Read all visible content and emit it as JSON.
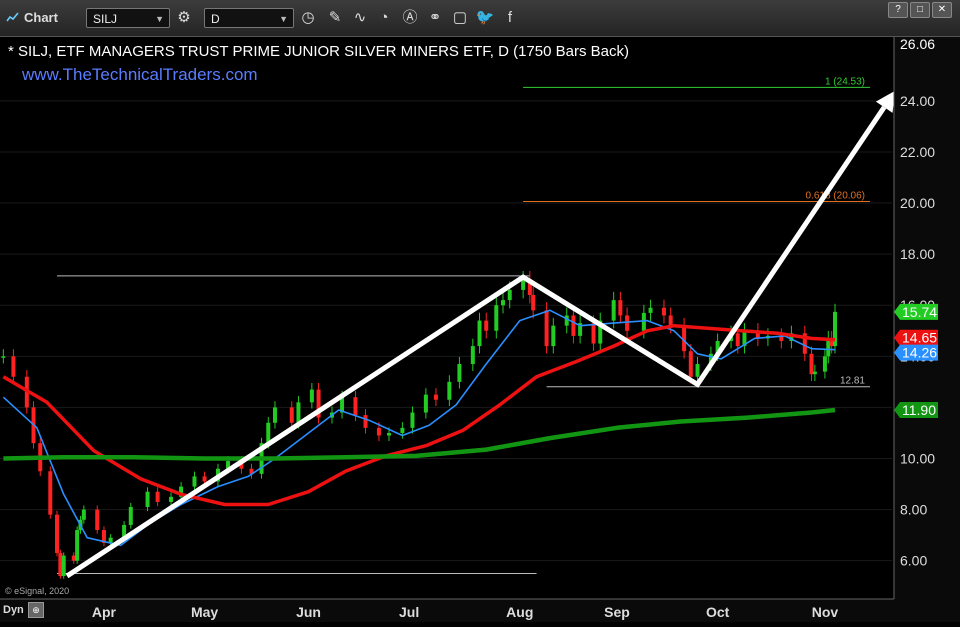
{
  "toolbar": {
    "title": "Chart",
    "symbol": "SILJ",
    "interval": "D",
    "win_buttons": [
      "?",
      "□",
      "✕"
    ]
  },
  "header": {
    "title": "* SILJ, ETF MANAGERS TRUST PRIME JUNIOR SILVER MINERS ETF, D (1750 Bars Back)",
    "website": "www.TheTechnicalTraders.com",
    "copyright": "© eSignal, 2020"
  },
  "footer": {
    "dyn_label": "Dyn"
  },
  "colors": {
    "bg": "#000000",
    "up": "#22cc22",
    "down": "#ff2222",
    "ma_fast": "#2a8fff",
    "ma_mid": "#ee1111",
    "ma_slow": "#129512",
    "fib1": "#33cc33",
    "fib618": "#e07020",
    "arrow": "#ffffff",
    "website": "#5a7dff"
  },
  "chart_data": {
    "type": "candlestick",
    "title": "* SILJ, ETF MANAGERS TRUST PRIME JUNIOR SILVER MINERS ETF, D (1750 Bars Back)",
    "ylim": [
      4.5,
      26.5
    ],
    "y_ticks": [
      6.0,
      8.0,
      10.0,
      12.0,
      14.0,
      16.0,
      18.0,
      20.0,
      22.0,
      24.0
    ],
    "y_tick_labels": [
      "6.00",
      "8.00",
      "10.00",
      "12.00",
      "14.00",
      "16.00",
      "18.00",
      "20.00",
      "22.00",
      "24.00"
    ],
    "top_label": "26.06",
    "x_labels": [
      {
        "label": "Apr",
        "date": "2020-04-01"
      },
      {
        "label": "May",
        "date": "2020-05-01"
      },
      {
        "label": "Jun",
        "date": "2020-06-01"
      },
      {
        "label": "Jul",
        "date": "2020-07-01"
      },
      {
        "label": "Aug",
        "date": "2020-08-03"
      },
      {
        "label": "Sep",
        "date": "2020-09-01"
      },
      {
        "label": "Oct",
        "date": "2020-10-01"
      },
      {
        "label": "Nov",
        "date": "2020-11-02"
      }
    ],
    "x_range": [
      "2020-03-01",
      "2020-11-22"
    ],
    "close_series": [
      [
        "2020-03-02",
        14.0
      ],
      [
        "2020-03-05",
        13.2
      ],
      [
        "2020-03-09",
        12.0
      ],
      [
        "2020-03-11",
        10.6
      ],
      [
        "2020-03-13",
        9.5
      ],
      [
        "2020-03-16",
        7.8
      ],
      [
        "2020-03-18",
        6.3
      ],
      [
        "2020-03-19",
        5.4
      ],
      [
        "2020-03-20",
        6.2
      ],
      [
        "2020-03-23",
        6.0
      ],
      [
        "2020-03-24",
        7.2
      ],
      [
        "2020-03-25",
        7.6
      ],
      [
        "2020-03-26",
        8.0
      ],
      [
        "2020-03-30",
        7.2
      ],
      [
        "2020-04-01",
        6.7
      ],
      [
        "2020-04-03",
        6.9
      ],
      [
        "2020-04-07",
        7.4
      ],
      [
        "2020-04-09",
        8.1
      ],
      [
        "2020-04-14",
        8.7
      ],
      [
        "2020-04-17",
        8.3
      ],
      [
        "2020-04-21",
        8.5
      ],
      [
        "2020-04-24",
        8.9
      ],
      [
        "2020-04-28",
        9.3
      ],
      [
        "2020-05-01",
        9.1
      ],
      [
        "2020-05-05",
        9.6
      ],
      [
        "2020-05-08",
        9.9
      ],
      [
        "2020-05-12",
        9.6
      ],
      [
        "2020-05-15",
        9.4
      ],
      [
        "2020-05-18",
        10.6
      ],
      [
        "2020-05-20",
        11.4
      ],
      [
        "2020-05-22",
        12.0
      ],
      [
        "2020-05-27",
        11.4
      ],
      [
        "2020-05-29",
        12.2
      ],
      [
        "2020-06-02",
        12.7
      ],
      [
        "2020-06-04",
        11.6
      ],
      [
        "2020-06-08",
        11.8
      ],
      [
        "2020-06-11",
        12.4
      ],
      [
        "2020-06-15",
        11.7
      ],
      [
        "2020-06-18",
        11.2
      ],
      [
        "2020-06-22",
        10.9
      ],
      [
        "2020-06-25",
        11.0
      ],
      [
        "2020-06-29",
        11.2
      ],
      [
        "2020-07-02",
        11.8
      ],
      [
        "2020-07-06",
        12.5
      ],
      [
        "2020-07-09",
        12.3
      ],
      [
        "2020-07-13",
        13.0
      ],
      [
        "2020-07-16",
        13.7
      ],
      [
        "2020-07-20",
        14.4
      ],
      [
        "2020-07-22",
        15.4
      ],
      [
        "2020-07-24",
        15.0
      ],
      [
        "2020-07-27",
        16.0
      ],
      [
        "2020-07-29",
        16.2
      ],
      [
        "2020-07-31",
        16.6
      ],
      [
        "2020-08-04",
        17.0
      ],
      [
        "2020-08-06",
        16.4
      ],
      [
        "2020-08-07",
        15.8
      ],
      [
        "2020-08-11",
        14.4
      ],
      [
        "2020-08-13",
        15.2
      ],
      [
        "2020-08-17",
        15.6
      ],
      [
        "2020-08-19",
        14.8
      ],
      [
        "2020-08-21",
        15.3
      ],
      [
        "2020-08-25",
        14.5
      ],
      [
        "2020-08-27",
        15.4
      ],
      [
        "2020-08-31",
        16.2
      ],
      [
        "2020-09-02",
        15.6
      ],
      [
        "2020-09-04",
        15.0
      ],
      [
        "2020-09-09",
        15.7
      ],
      [
        "2020-09-11",
        15.9
      ],
      [
        "2020-09-15",
        15.6
      ],
      [
        "2020-09-17",
        15.2
      ],
      [
        "2020-09-21",
        14.2
      ],
      [
        "2020-09-23",
        13.2
      ],
      [
        "2020-09-25",
        13.7
      ],
      [
        "2020-09-29",
        14.1
      ],
      [
        "2020-10-01",
        14.6
      ],
      [
        "2020-10-05",
        14.9
      ],
      [
        "2020-10-07",
        14.4
      ],
      [
        "2020-10-09",
        15.0
      ],
      [
        "2020-10-13",
        14.7
      ],
      [
        "2020-10-16",
        14.8
      ],
      [
        "2020-10-20",
        14.6
      ],
      [
        "2020-10-23",
        14.9
      ],
      [
        "2020-10-27",
        14.1
      ],
      [
        "2020-10-29",
        13.3
      ],
      [
        "2020-10-30",
        13.4
      ],
      [
        "2020-11-02",
        14.0
      ],
      [
        "2020-11-03",
        14.7
      ],
      [
        "2020-11-04",
        14.4
      ],
      [
        "2020-11-05",
        15.74
      ]
    ],
    "moving_averages": [
      {
        "name": "fast",
        "color": "#2a8fff",
        "last": 14.26,
        "points": [
          [
            "2020-03-02",
            12.4
          ],
          [
            "2020-03-12",
            11.2
          ],
          [
            "2020-03-20",
            8.6
          ],
          [
            "2020-03-27",
            6.9
          ],
          [
            "2020-04-06",
            6.6
          ],
          [
            "2020-04-15",
            7.5
          ],
          [
            "2020-04-24",
            8.2
          ],
          [
            "2020-05-05",
            8.9
          ],
          [
            "2020-05-14",
            9.3
          ],
          [
            "2020-05-22",
            10.0
          ],
          [
            "2020-06-01",
            11.0
          ],
          [
            "2020-06-10",
            11.9
          ],
          [
            "2020-06-19",
            11.5
          ],
          [
            "2020-06-29",
            10.9
          ],
          [
            "2020-07-07",
            11.3
          ],
          [
            "2020-07-15",
            12.1
          ],
          [
            "2020-07-24",
            13.7
          ],
          [
            "2020-08-03",
            15.4
          ],
          [
            "2020-08-12",
            15.8
          ],
          [
            "2020-08-21",
            15.2
          ],
          [
            "2020-08-31",
            15.3
          ],
          [
            "2020-09-10",
            15.4
          ],
          [
            "2020-09-18",
            15.0
          ],
          [
            "2020-09-25",
            14.1
          ],
          [
            "2020-10-02",
            13.9
          ],
          [
            "2020-10-12",
            14.7
          ],
          [
            "2020-10-21",
            14.8
          ],
          [
            "2020-10-29",
            14.3
          ],
          [
            "2020-11-05",
            14.26
          ]
        ]
      },
      {
        "name": "mid",
        "color": "#ee1111",
        "last": 14.65,
        "points": [
          [
            "2020-03-02",
            13.2
          ],
          [
            "2020-03-15",
            12.2
          ],
          [
            "2020-03-29",
            10.3
          ],
          [
            "2020-04-12",
            9.2
          ],
          [
            "2020-04-24",
            8.6
          ],
          [
            "2020-05-07",
            8.2
          ],
          [
            "2020-05-20",
            8.2
          ],
          [
            "2020-06-01",
            8.7
          ],
          [
            "2020-06-12",
            9.5
          ],
          [
            "2020-06-24",
            10.1
          ],
          [
            "2020-07-06",
            10.5
          ],
          [
            "2020-07-17",
            11.1
          ],
          [
            "2020-07-28",
            12.1
          ],
          [
            "2020-08-08",
            13.2
          ],
          [
            "2020-08-20",
            13.8
          ],
          [
            "2020-08-31",
            14.4
          ],
          [
            "2020-09-10",
            15.0
          ],
          [
            "2020-09-18",
            15.2
          ],
          [
            "2020-09-28",
            15.1
          ],
          [
            "2020-10-08",
            15.0
          ],
          [
            "2020-10-19",
            14.9
          ],
          [
            "2020-10-29",
            14.7
          ],
          [
            "2020-11-05",
            14.65
          ]
        ]
      },
      {
        "name": "slow",
        "color": "#129512",
        "last": 11.9,
        "points": [
          [
            "2020-03-02",
            10.0
          ],
          [
            "2020-03-20",
            10.05
          ],
          [
            "2020-04-10",
            10.05
          ],
          [
            "2020-05-01",
            10.0
          ],
          [
            "2020-05-22",
            10.0
          ],
          [
            "2020-06-12",
            10.05
          ],
          [
            "2020-07-03",
            10.1
          ],
          [
            "2020-07-24",
            10.35
          ],
          [
            "2020-08-12",
            10.8
          ],
          [
            "2020-09-01",
            11.2
          ],
          [
            "2020-09-20",
            11.45
          ],
          [
            "2020-10-10",
            11.6
          ],
          [
            "2020-10-29",
            11.8
          ],
          [
            "2020-11-05",
            11.9
          ]
        ]
      }
    ],
    "annotations": [
      {
        "kind": "fib",
        "label": "1 (24.53)",
        "value": 24.53,
        "color": "#33cc33",
        "from": "2020-08-04"
      },
      {
        "kind": "fib",
        "label": "0.618 (20.06)",
        "value": 20.06,
        "color": "#e07020",
        "from": "2020-08-04"
      },
      {
        "kind": "level",
        "label": "12.81",
        "value": 12.81,
        "from": "2020-08-11"
      },
      {
        "kind": "hline",
        "value": 17.15,
        "from": "2020-03-18",
        "to": "2020-08-06"
      },
      {
        "kind": "hline",
        "value": 5.5,
        "from": "2020-03-18",
        "to": "2020-08-08"
      }
    ],
    "arrow_path": [
      [
        "2020-03-21",
        5.4
      ],
      [
        "2020-08-04",
        17.1
      ],
      [
        "2020-09-25",
        12.9
      ],
      [
        "2020-11-23",
        24.4
      ]
    ],
    "price_tags": [
      {
        "value": 15.74,
        "label": "15.74",
        "color": "#22cc22"
      },
      {
        "value": 14.65,
        "label": "14.65",
        "color": "#ee1111"
      },
      {
        "value": 14.26,
        "label": "14.26",
        "color": "#2a8fff"
      },
      {
        "value": 11.9,
        "label": "11.90",
        "color": "#129512"
      }
    ]
  }
}
